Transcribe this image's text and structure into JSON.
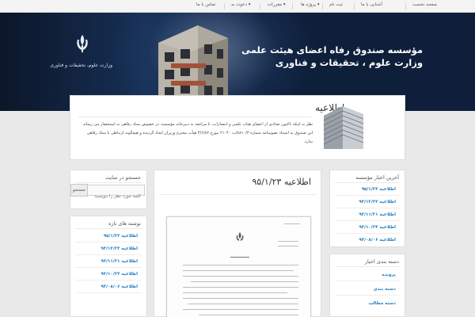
{
  "nav": {
    "items": [
      {
        "label": "صفحه نخست"
      },
      {
        "label": "آشنایی با ما"
      },
      {
        "label": "ثبت نام"
      },
      {
        "label": "پروژه ها"
      },
      {
        "label": "مقررات"
      },
      {
        "label": "دعوت به"
      },
      {
        "label": "تماس با ما"
      }
    ]
  },
  "banner": {
    "title_line1": "مؤسسه صندوق رفاه اعضای هیئت علمی",
    "title_line2": "وزارت علوم ، تحقیقات و فناوری",
    "emblem_caption": "وزارت علوم، تحقیقات و فناوری"
  },
  "notice": {
    "title": "اطلاعیه",
    "body": "نظر به اینکه تاکنون تعدادی از اعضای هیات علمی و انتشارات، با مراجعه به دبیرخانه مؤسسه، در خصوص ستاد رفاهی به استحضار می رساند این صندوق به استناد تصویبنامه شماره ۸۸۱۰/۳/ت ۲۱۰۴۰ مورخ ۳/۶/۸۲ هیأت محترم وزیران ایجاد گردیده و هیچگونه ارتباطی با ستاد رفاهی ندارد."
  },
  "search": {
    "title": "جستجو در سایت",
    "placeholder": "کلمه مورد نظر را بنویسید",
    "button": "جستجو"
  },
  "recent_posts": {
    "title": "نوشته های تازه",
    "items": [
      {
        "label": "اطلاعیه ۹۵/۱/۲۳"
      },
      {
        "label": "اطلاعیه ۹۴/۱۲/۲۳"
      },
      {
        "label": "اطلاعیه ۹۴/۱۱/۲۱"
      },
      {
        "label": "اطلاعیه ۹۴/۱۰/۲۴"
      },
      {
        "label": "اطلاعیه ۹۴/۰۸/۰۶"
      }
    ]
  },
  "post": {
    "title": "اطلاعیه ۹۵/۱/۲۳"
  },
  "latest_news": {
    "title": "آخرین اخبار مؤسسه",
    "items": [
      {
        "label": "اطلاعیه ۹۵/۱/۲۳"
      },
      {
        "label": "اطلاعیه ۹۴/۱۲/۲۳"
      },
      {
        "label": "اطلاعیه ۹۴/۱۱/۲۱"
      },
      {
        "label": "اطلاعیه ۹۴/۱۰/۲۴"
      },
      {
        "label": "اطلاعیه ۹۴/۰۸/۰۶"
      }
    ]
  },
  "categories": {
    "title": "دسته بندی اخبار",
    "items": [
      {
        "label": "پرونده"
      },
      {
        "label": "دسته بندی"
      },
      {
        "label": "دسته مطالب"
      }
    ]
  },
  "colors": {
    "link": "#1f7dc0",
    "banner_bg": "#0e1f3a"
  }
}
